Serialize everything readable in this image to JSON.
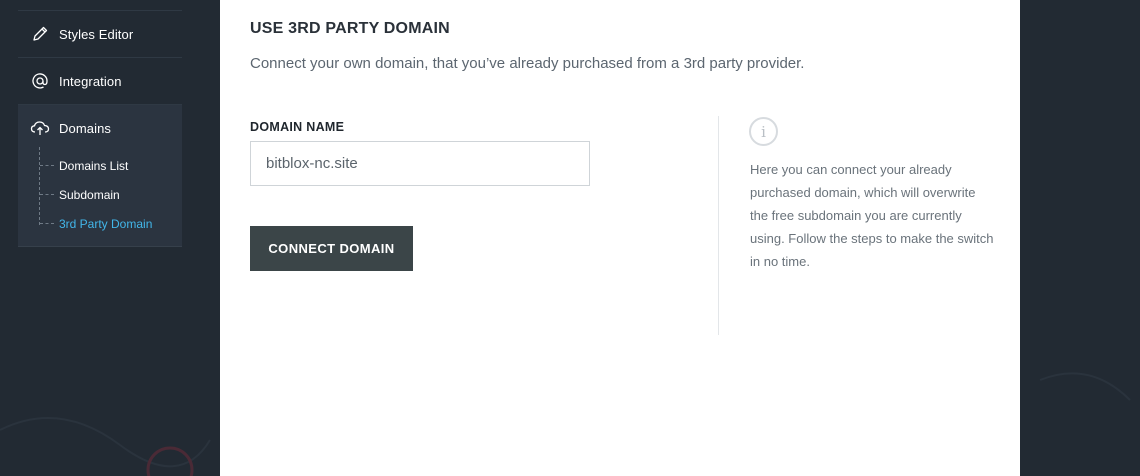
{
  "sidebar": {
    "items": [
      {
        "label": "Styles Editor",
        "icon": "pencil-icon"
      },
      {
        "label": "Integration",
        "icon": "at-sign-icon"
      },
      {
        "label": "Domains",
        "icon": "cloud-upload-icon"
      }
    ],
    "sub_items": [
      {
        "label": "Domains List",
        "active": false
      },
      {
        "label": "Subdomain",
        "active": false
      },
      {
        "label": "3rd Party Domain",
        "active": true
      }
    ]
  },
  "main": {
    "title": "USE 3RD PARTY DOMAIN",
    "description": "Connect your own domain, that you’ve already purchased from a 3rd party provider.",
    "domain_field": {
      "label": "DOMAIN NAME",
      "value": "bitblox-nc.site"
    },
    "connect_button": "CONNECT DOMAIN",
    "info_icon": "i",
    "info_text": "Here you can connect your already purchased domain, which will overwrite the free subdomain you are currently using. Follow the steps to make the switch in no time."
  },
  "colors": {
    "background": "#222a33",
    "active_link": "#42b6e9",
    "button": "#3b4548"
  }
}
